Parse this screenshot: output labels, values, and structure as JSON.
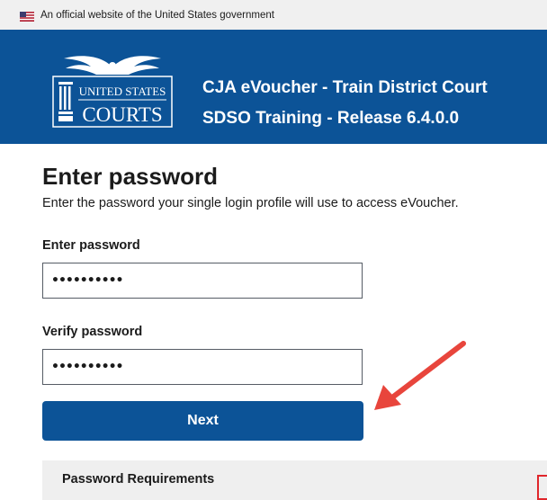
{
  "gov_banner": {
    "text": "An official website of the United States government",
    "icon": "us-flag-icon"
  },
  "header": {
    "logo_icon": "united-states-courts-eagle-logo",
    "logo_line1": "UNITED STATES",
    "logo_line2": "COURTS",
    "title": "CJA eVoucher - Train District Court",
    "subtitle": "SDSO Training - Release 6.4.0.0",
    "background_color": "#0c5397"
  },
  "main": {
    "heading": "Enter password",
    "description": "Enter the password your single login profile will use to access eVoucher.",
    "fields": [
      {
        "label": "Enter password",
        "value": "••••••••••"
      },
      {
        "label": "Verify password",
        "value": "••••••••••"
      }
    ],
    "next_label": "Next",
    "requirements_title": "Password Requirements"
  },
  "annotation": {
    "arrow_color": "#e8453c",
    "highlight_color": "#e0262b"
  }
}
